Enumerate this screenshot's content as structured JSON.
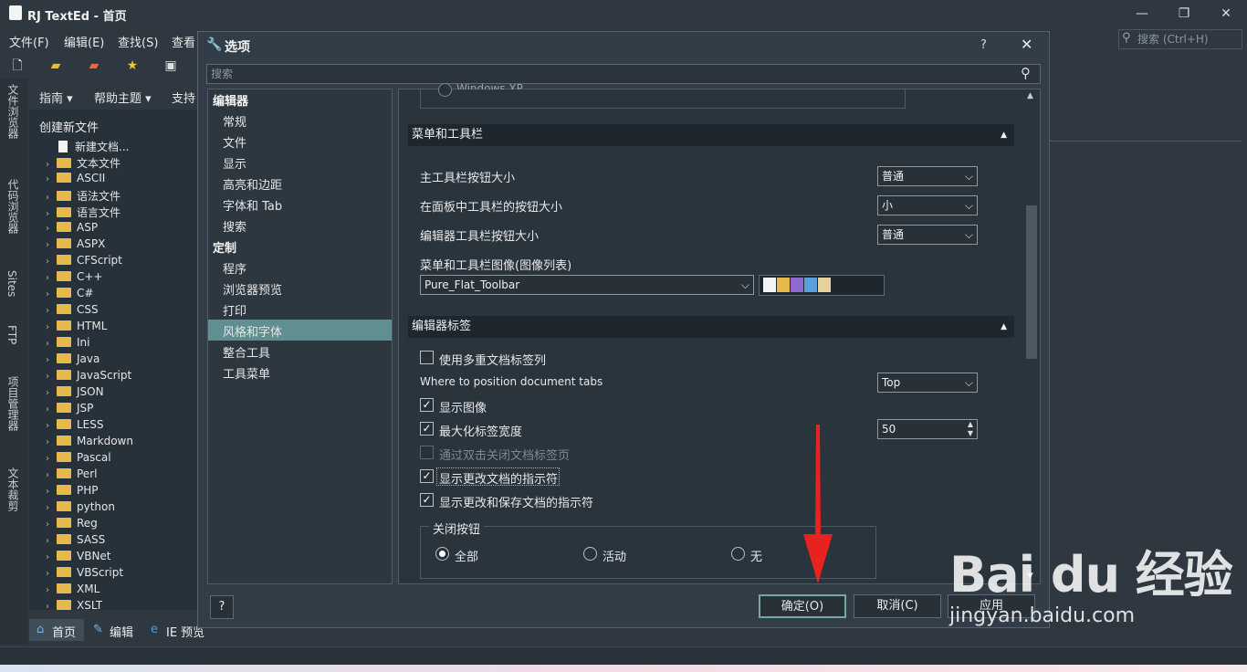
{
  "app": {
    "title": "RJ TextEd - 首页",
    "win_min": "—",
    "win_restore": "❐",
    "win_close": "✕"
  },
  "menubar": {
    "items": [
      "文件(F)",
      "编辑(E)",
      "查找(S)",
      "查看"
    ]
  },
  "search_main": {
    "placeholder": "搜索 (Ctrl+H)"
  },
  "left_tabs": [
    "文件浏览器",
    "代码浏览器",
    "Sites",
    "FTP",
    "项目管理器",
    "文本裁剪"
  ],
  "nav2": {
    "items": [
      "指南 ▾",
      "帮助主题 ▾",
      "支持"
    ]
  },
  "filetree": {
    "header": "创建新文件",
    "new_doc": "新建文档...",
    "items": [
      "文本文件",
      "ASCII",
      "语法文件",
      "语言文件",
      "ASP",
      "ASPX",
      "CFScript",
      "C++",
      "C#",
      "CSS",
      "HTML",
      "Ini",
      "Java",
      "JavaScript",
      "JSON",
      "JSP",
      "LESS",
      "Markdown",
      "Pascal",
      "Perl",
      "PHP",
      "python",
      "Reg",
      "SASS",
      "VBNet",
      "VBScript",
      "XML",
      "XSLT"
    ]
  },
  "bottom_tabs": [
    "首页",
    "编辑",
    "IE 预览"
  ],
  "dialog": {
    "title": "选项",
    "help": "?",
    "close": "✕",
    "search_placeholder": "搜索",
    "categories": [
      {
        "label": "编辑器",
        "header": true
      },
      {
        "label": "常规"
      },
      {
        "label": "文件"
      },
      {
        "label": "显示"
      },
      {
        "label": "高亮和边距"
      },
      {
        "label": "字体和 Tab"
      },
      {
        "label": "搜索"
      },
      {
        "label": "定制",
        "header": true
      },
      {
        "label": "程序"
      },
      {
        "label": "浏览器预览"
      },
      {
        "label": "打印"
      },
      {
        "label": "风格和字体",
        "selected": true
      },
      {
        "label": "整合工具"
      },
      {
        "label": "工具菜单"
      }
    ],
    "top_clip": "Windows XP",
    "sec_menu": "菜单和工具栏",
    "main_toolbar_size_label": "主工具栏按钮大小",
    "main_toolbar_size": "普通",
    "panel_toolbar_size_label": "在面板中工具栏的按钮大小",
    "panel_toolbar_size": "小",
    "editor_toolbar_size_label": "编辑器工具栏按钮大小",
    "editor_toolbar_size": "普通",
    "image_list_label": "菜单和工具栏图像(图像列表)",
    "image_list": "Pure_Flat_Toolbar",
    "sec_tabs": "编辑器标签",
    "multi_row_label": "使用多重文档标签列",
    "tab_pos_label": "Where to position document tabs",
    "tab_pos": "Top",
    "show_images_label": "显示图像",
    "max_width_label": "最大化标签宽度",
    "max_width": "50",
    "dblclick_close_label": "通过双击关闭文档标签页",
    "show_modified_label": "显示更改文档的指示符",
    "show_modsaved_label": "显示更改和保存文档的指示符",
    "close_group": "关闭按钮",
    "radio_all": "全部",
    "radio_active": "活动",
    "radio_none": "无",
    "ok": "确定(O)",
    "cancel": "取消(C)",
    "apply": "应用",
    "bottom_help": "?"
  },
  "watermark": {
    "logo": "Bai du 经验",
    "url": "jingyan.baidu.com"
  },
  "colors": {
    "accent_selected": "#5f8f90",
    "arrow": "#e8231f"
  }
}
